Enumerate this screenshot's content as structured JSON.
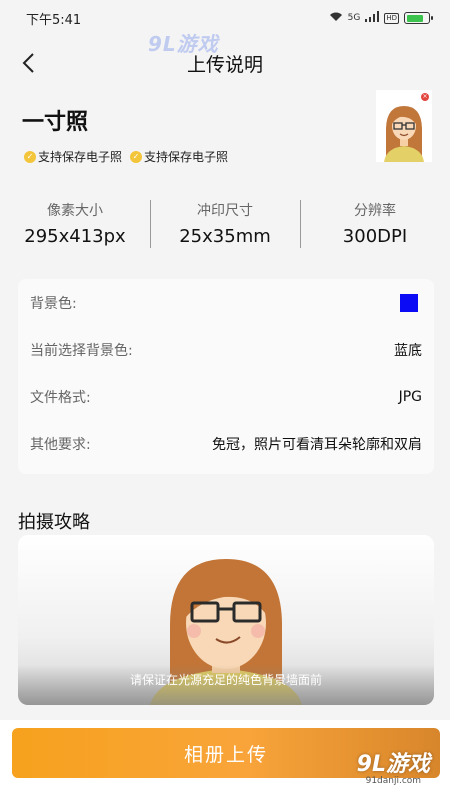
{
  "status_bar": {
    "time": "下午5:41",
    "network": "5G",
    "hd": "HD",
    "battery_level": 0.8
  },
  "watermark": {
    "brand": "9L游戏",
    "url": "91danji.com"
  },
  "nav": {
    "title": "上传说明"
  },
  "photo": {
    "title": "一寸照",
    "tags": [
      "支持保存电子照",
      "支持保存电子照"
    ]
  },
  "specs": [
    {
      "label": "像素大小",
      "value": "295x413px"
    },
    {
      "label": "冲印尺寸",
      "value": "25x35mm"
    },
    {
      "label": "分辨率",
      "value": "300DPI"
    }
  ],
  "info": {
    "bg_color_label": "背景色:",
    "bg_color_value": "#0b0bf5",
    "selected_bg_label": "当前选择背景色:",
    "selected_bg_value": "蓝底",
    "format_label": "文件格式:",
    "format_value": "JPG",
    "other_label": "其他要求:",
    "other_value": "免冠，照片可看清耳朵轮廓和双肩"
  },
  "guide": {
    "title": "拍摄攻略",
    "caption": "请保证在光源充足的纯色背景墙面前"
  },
  "actions": {
    "upload_label": "相册上传"
  },
  "colors": {
    "accent": "#f7a21d",
    "tag_check": "#f3c53b"
  }
}
